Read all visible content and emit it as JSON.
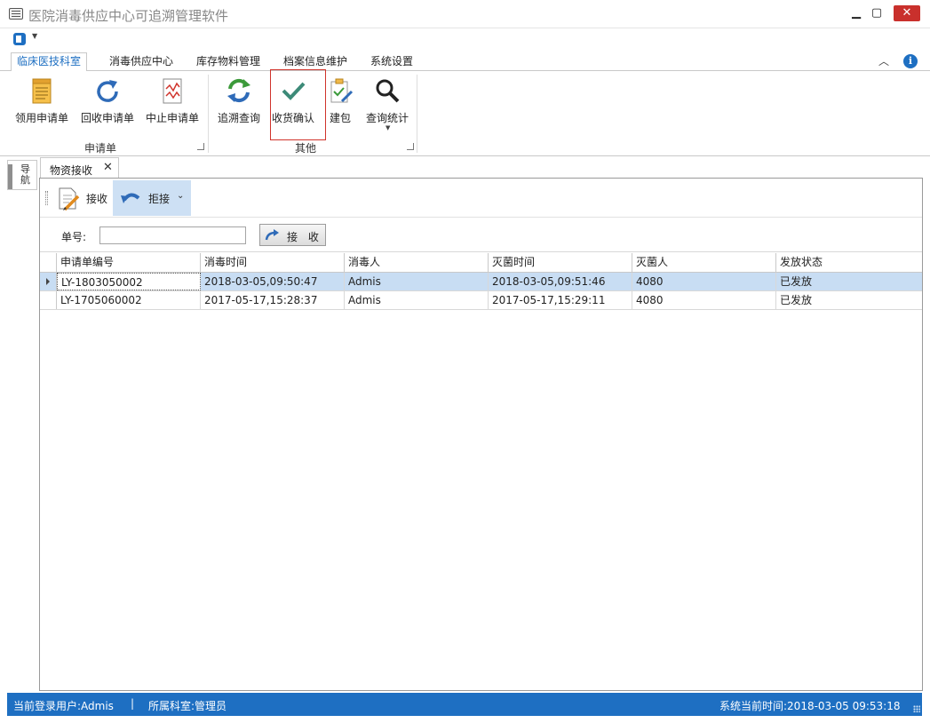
{
  "window": {
    "title": "医院消毒供应中心可追溯管理软件",
    "min_glyph": "▁",
    "max_glyph": "▢",
    "close_glyph": "✕"
  },
  "qat": {
    "dropdown_glyph": "▼"
  },
  "ribbon": {
    "tabs": [
      {
        "label": "临床医技科室",
        "active": true
      },
      {
        "label": "消毒供应中心",
        "active": false
      },
      {
        "label": "库存物料管理",
        "active": false
      },
      {
        "label": "档案信息维护",
        "active": false
      },
      {
        "label": "系统设置",
        "active": false
      }
    ],
    "collapse_glyph": "︿",
    "info_glyph": "i",
    "groups": [
      {
        "label": "申请单",
        "buttons": [
          {
            "label": "领用申请单",
            "icon": "notepad-icon"
          },
          {
            "label": "回收申请单",
            "icon": "refresh-icon"
          },
          {
            "label": "中止申请单",
            "icon": "chart-doc-icon"
          }
        ]
      },
      {
        "label": "其他",
        "buttons": [
          {
            "label": "追溯查询",
            "icon": "cycle-arrows-icon"
          },
          {
            "label": "收货确认",
            "icon": "checkmark-icon"
          },
          {
            "label": "建包",
            "icon": "clipboard-pen-icon"
          },
          {
            "label": "查询统计",
            "icon": "magnifier-icon"
          }
        ]
      }
    ]
  },
  "side_panel": {
    "label": "导航"
  },
  "document": {
    "tab_label": "物资接收",
    "tab_close_glyph": "✕",
    "toolbar": {
      "receive_label": "接收",
      "reject_label": "拒接",
      "reject_dropdown_glyph": "⌄"
    },
    "filter": {
      "order_label": "单号:",
      "order_value": "",
      "receive_button_label": "接 收"
    },
    "grid": {
      "columns": [
        "申请单编号",
        "消毒时间",
        "消毒人",
        "灭菌时间",
        "灭菌人",
        "发放状态"
      ],
      "rows": [
        [
          "LY-1803050002",
          "2018-03-05,09:50:47",
          "Admis",
          "2018-03-05,09:51:46",
          "4080",
          "已发放"
        ],
        [
          "LY-1705060002",
          "2017-05-17,15:28:37",
          "Admis",
          "2017-05-17,15:29:11",
          "4080",
          "已发放"
        ]
      ],
      "selected_row": 0
    }
  },
  "status": {
    "user": "当前登录用户:Admis",
    "separator": "|",
    "dept": "所属科室:管理员",
    "time": "系统当前时间:2018-03-05 09:53:18"
  },
  "colors": {
    "accent": "#1e6fc2",
    "selection": "#c8ddf3",
    "highlight_frame": "#d0342c",
    "close_button": "#c9302c"
  }
}
